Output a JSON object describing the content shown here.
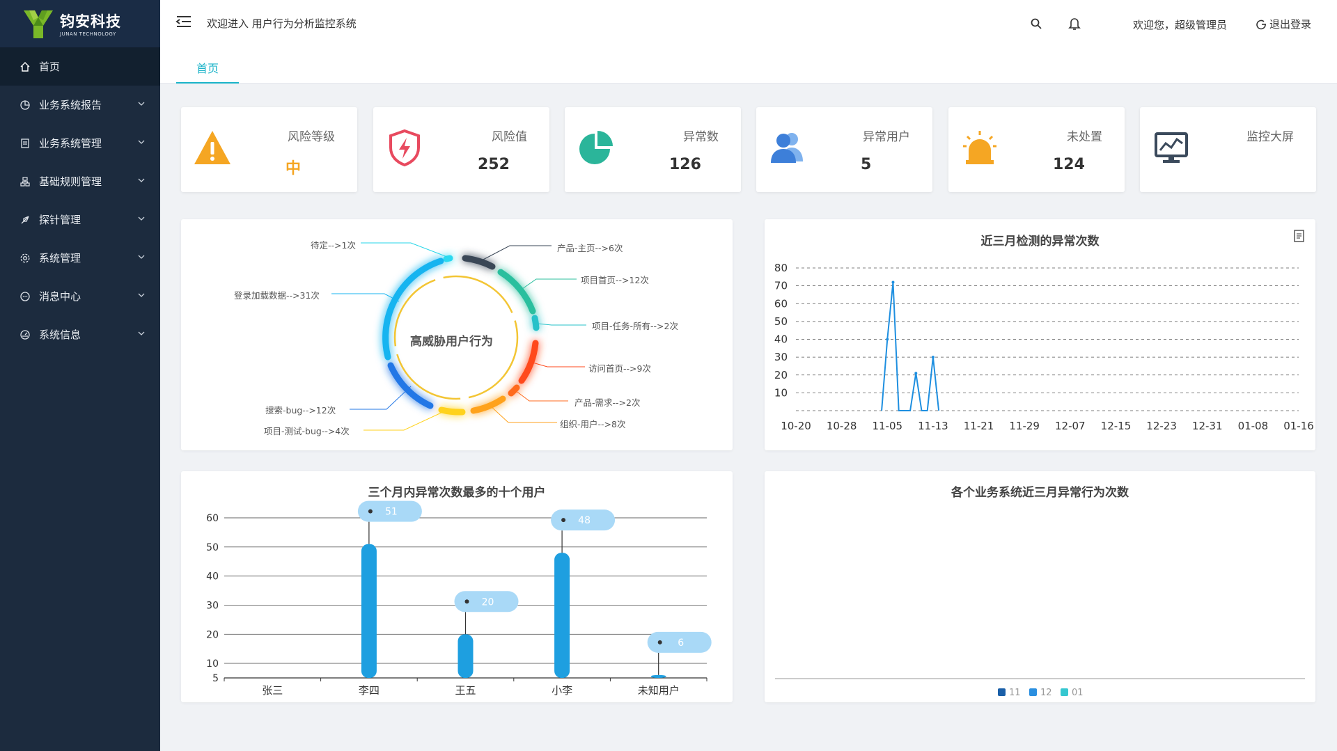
{
  "brand": {
    "name_cn": "钧安科技",
    "name_en": "JUNAN TECHNOLOGY"
  },
  "sidebar": {
    "items": [
      {
        "label": "首页",
        "icon": "home-icon"
      },
      {
        "label": "业务系统报告",
        "icon": "pie-icon"
      },
      {
        "label": "业务系统管理",
        "icon": "doc-icon"
      },
      {
        "label": "基础规则管理",
        "icon": "sitemap-icon"
      },
      {
        "label": "探针管理",
        "icon": "rocket-icon"
      },
      {
        "label": "系统管理",
        "icon": "gear-icon"
      },
      {
        "label": "消息中心",
        "icon": "message-icon"
      },
      {
        "label": "系统信息",
        "icon": "dashboard-icon"
      }
    ]
  },
  "header": {
    "title": "欢迎进入 用户行为分析监控系统",
    "greeting": "欢迎您，超级管理员",
    "logout": "退出登录"
  },
  "tabs": [
    {
      "label": "首页"
    }
  ],
  "stats": [
    {
      "label": "风险等级",
      "value": "中",
      "icon": "warning-icon",
      "color": "#f5a623"
    },
    {
      "label": "风险值",
      "value": "252",
      "icon": "shield-lightning-icon",
      "color": "#e84a5f"
    },
    {
      "label": "异常数",
      "value": "126",
      "icon": "pie-chart-icon",
      "color": "#2bb59a"
    },
    {
      "label": "异常用户",
      "value": "5",
      "icon": "users-icon",
      "color": "#3d7fd9"
    },
    {
      "label": "未处置",
      "value": "124",
      "icon": "alarm-light-icon",
      "color": "#f5a623"
    },
    {
      "label": "监控大屏",
      "value": "",
      "icon": "monitor-icon",
      "color": "#3b4a5c"
    }
  ],
  "ring": {
    "center": "高威胁用户行为",
    "annotations": [
      "待定-->1次",
      "产品-主页-->6次",
      "项目首页-->12次",
      "登录加载数据-->31次",
      "项目-任务-所有-->2次",
      "访问首页-->9次",
      "产品-需求-->2次",
      "组织-用户-->8次",
      "搜索-bug-->12次",
      "项目-测试-bug-->4次"
    ]
  },
  "colors": {
    "accent": "#1ab3c8",
    "sidebar": "#1c2b3e",
    "bar": "#1e9fe0"
  },
  "chart_data": [
    {
      "type": "line",
      "title": "近三月检测的异常次数",
      "x_ticks": [
        "10-20",
        "10-28",
        "11-05",
        "11-13",
        "11-21",
        "11-29",
        "12-07",
        "12-15",
        "12-23",
        "12-31",
        "01-08",
        "01-16"
      ],
      "y_ticks": [
        10,
        20,
        30,
        40,
        50,
        60,
        70,
        80
      ],
      "ylim": [
        0,
        80
      ],
      "grid": true,
      "points": [
        {
          "x": "11-04",
          "y": 0
        },
        {
          "x": "11-05",
          "y": 40
        },
        {
          "x": "11-06",
          "y": 72
        },
        {
          "x": "11-07",
          "y": 0
        },
        {
          "x": "11-09",
          "y": 0
        },
        {
          "x": "11-10",
          "y": 21
        },
        {
          "x": "11-11",
          "y": 0
        },
        {
          "x": "11-12",
          "y": 0
        },
        {
          "x": "11-13",
          "y": 30
        },
        {
          "x": "11-14",
          "y": 0
        }
      ]
    },
    {
      "type": "bar",
      "title": "三个月内异常次数最多的十个用户",
      "categories": [
        "张三",
        "李四",
        "王五",
        "小李",
        "未知用户"
      ],
      "values": [
        0,
        51,
        20,
        48,
        6
      ],
      "y_ticks": [
        5,
        10,
        20,
        30,
        40,
        50,
        60
      ],
      "ylim": [
        5,
        60
      ]
    },
    {
      "type": "bar",
      "title": "各个业务系统近三月异常行为次数",
      "categories": [],
      "series": [
        {
          "name": "11",
          "color": "#1a5fa8"
        },
        {
          "name": "12",
          "color": "#2a8fe0"
        },
        {
          "name": "01",
          "color": "#36c7d0"
        }
      ]
    }
  ]
}
